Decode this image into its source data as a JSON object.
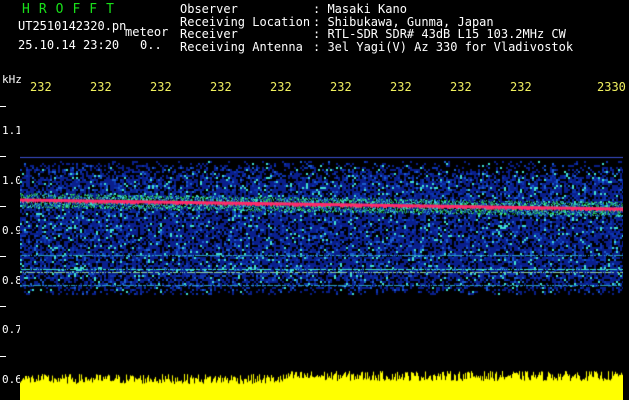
{
  "header": {
    "logo": "HROFFT",
    "filename": "UT2510142320.pn",
    "tag": "meteor",
    "datetime": "25.10.14 23:20",
    "datetime_suffix": "0..",
    "meta": [
      {
        "key": "Observer",
        "value": ": Masaki Kano"
      },
      {
        "key": "Receiving Location",
        "value": ": Shibukawa, Gunma, Japan"
      },
      {
        "key": "Receiver",
        "value": ": RTL-SDR SDR# 43dB L15 103.2MHz CW"
      },
      {
        "key": "Receiving Antenna",
        "value": ": 3el Yagi(V) Az 330 for Vladivostok"
      }
    ]
  },
  "axis": {
    "y_unit": "kHz",
    "x_ticks": [
      "232",
      "232",
      "232",
      "232",
      "232",
      "232",
      "232",
      "232",
      "232",
      "2330"
    ],
    "y_ticks": [
      "1.1",
      "1.0",
      "0.9",
      "0.8",
      "0.7",
      "0.6"
    ]
  },
  "colors": {
    "noise": "#0a1f8c",
    "signal_cyan": "#3fe0d0",
    "signal_green": "#2bd34a",
    "carrier": "#ff2a6a",
    "bottom_band": "#ffff00"
  }
}
